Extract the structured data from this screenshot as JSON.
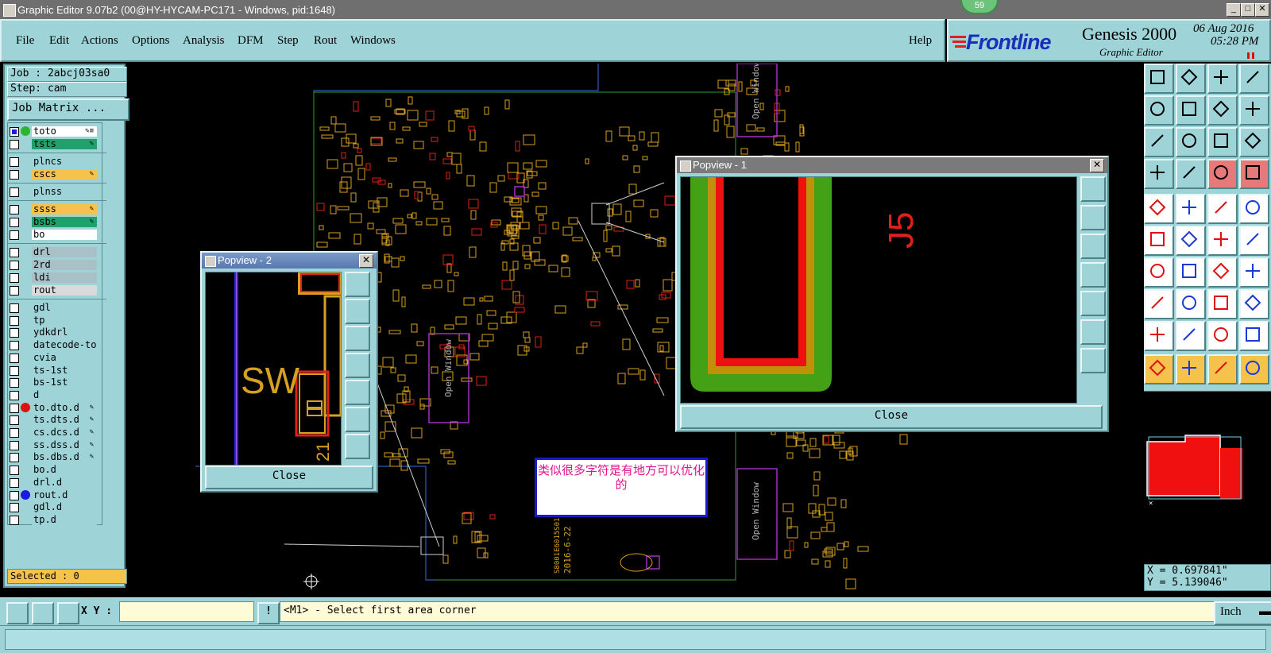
{
  "window": {
    "title": "Graphic Editor 9.07b2 (00@HY-HYCAM-PC171 - Windows, pid:1648)",
    "badge": "59",
    "buttons": [
      "_",
      "□",
      "✕"
    ]
  },
  "menu": [
    "File",
    "Edit",
    "Actions",
    "Options",
    "Analysis",
    "DFM",
    "Step",
    "Rout",
    "Windows"
  ],
  "help_label": "Help",
  "brand": {
    "logo": "Frontline",
    "product": "Genesis 2000",
    "subtitle": "Graphic Editor",
    "date": "06 Aug 2016",
    "time": "05:28 PM"
  },
  "job": {
    "job_line": "Job : 2abcj03sa0",
    "step_line": "Step: cam",
    "matrix_button": "Job Matrix ..."
  },
  "layers": [
    {
      "name": "to",
      "color": "#ffffff",
      "dot": "#2db52d",
      "mark": "✎≡"
    },
    {
      "name": "ts",
      "color": "#22a06b",
      "dot": "",
      "mark": "✎"
    },
    {
      "name": "plncs",
      "color": "#9ed4d8",
      "dot": "",
      "mark": ""
    },
    {
      "name": "cs",
      "color": "#f5c34c",
      "dot": "",
      "mark": "✎"
    },
    {
      "name": "plnss",
      "color": "#9ed4d8",
      "dot": "",
      "mark": ""
    },
    {
      "name": "ss",
      "color": "#f5c34c",
      "dot": "",
      "mark": "✎"
    },
    {
      "name": "bs",
      "color": "#22a06b",
      "dot": "",
      "mark": "✎"
    },
    {
      "name": "bo",
      "color": "#ffffff",
      "dot": "",
      "mark": ""
    },
    {
      "name": "drl",
      "color": "#a9c0c6",
      "dot": "",
      "mark": ""
    },
    {
      "name": "2rd",
      "color": "#a9c0c6",
      "dot": "",
      "mark": ""
    },
    {
      "name": "ldi",
      "color": "#a9c0c6",
      "dot": "",
      "mark": ""
    },
    {
      "name": "rout",
      "color": "#d8dadb",
      "dot": "",
      "mark": ""
    },
    {
      "name": "gdl",
      "color": "#9ed4d8",
      "dot": "",
      "mark": ""
    },
    {
      "name": "tp",
      "color": "#9ed4d8",
      "dot": "",
      "mark": ""
    },
    {
      "name": "ydkdrl",
      "color": "#9ed4d8",
      "dot": "",
      "mark": ""
    },
    {
      "name": "datecode-to",
      "color": "#9ed4d8",
      "dot": "",
      "mark": ""
    },
    {
      "name": "cvia",
      "color": "#9ed4d8",
      "dot": "",
      "mark": ""
    },
    {
      "name": "ts-1st",
      "color": "#9ed4d8",
      "dot": "",
      "mark": ""
    },
    {
      "name": "bs-1st",
      "color": "#9ed4d8",
      "dot": "",
      "mark": ""
    },
    {
      "name": "d",
      "color": "#9ed4d8",
      "dot": "",
      "mark": ""
    },
    {
      "name": "to.d",
      "color": "#9ed4d8",
      "dot": "#e01010",
      "mark": "✎"
    },
    {
      "name": "ts.d",
      "color": "#9ed4d8",
      "dot": "",
      "mark": "✎"
    },
    {
      "name": "cs.d",
      "color": "#9ed4d8",
      "dot": "",
      "mark": "✎"
    },
    {
      "name": "ss.d",
      "color": "#9ed4d8",
      "dot": "",
      "mark": "✎"
    },
    {
      "name": "bs.d",
      "color": "#9ed4d8",
      "dot": "",
      "mark": "✎"
    },
    {
      "name": "bo.d",
      "color": "#9ed4d8",
      "dot": "",
      "mark": ""
    },
    {
      "name": "drl.d",
      "color": "#9ed4d8",
      "dot": "",
      "mark": ""
    },
    {
      "name": "rout.d",
      "color": "#9ed4d8",
      "dot": "#1a1ae0",
      "mark": ""
    },
    {
      "name": "gdl.d",
      "color": "#9ed4d8",
      "dot": "",
      "mark": ""
    },
    {
      "name": "tp.d",
      "color": "#9ed4d8",
      "dot": "",
      "mark": ""
    }
  ],
  "selected": "Selected : 0",
  "coords": {
    "x": "X = 0.697841\"",
    "y": "Y = 5.139046\""
  },
  "bottom": {
    "xy_label": "X Y :",
    "xy_value": "",
    "prompt": "<M1> - Select first area corner",
    "unit": "Inch"
  },
  "popup1": {
    "title": "Popview - 1",
    "close": "Close",
    "label": "J5"
  },
  "popup2": {
    "title": "Popview - 2",
    "close": "Close",
    "label": "SW",
    "label2": "21"
  },
  "annotation": "类似很多字符是有地方可以优化的",
  "canvas_labels": {
    "open_window": "Open Window",
    "date_stamp": "2016-6-22",
    "code_stamp": "S8001E6015S01"
  }
}
